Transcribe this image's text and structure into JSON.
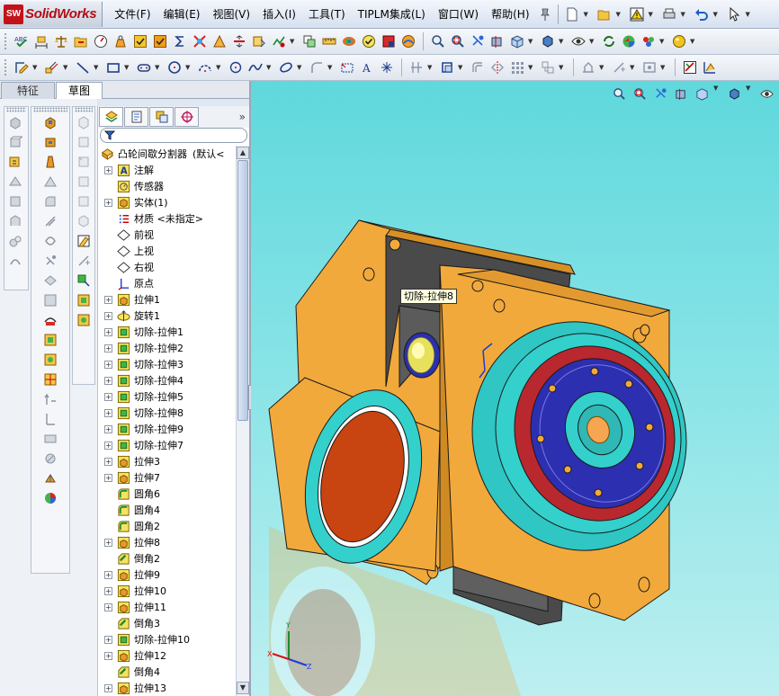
{
  "app": {
    "logo_badge": "SW",
    "logo_text": "SolidWorks"
  },
  "menu": [
    "文件(F)",
    "编辑(E)",
    "视图(V)",
    "插入(I)",
    "工具(T)",
    "TIPLM集成(L)",
    "窗口(W)",
    "帮助(H)"
  ],
  "command_tabs": {
    "features": "特征",
    "sketch": "草图"
  },
  "feature_tree": {
    "root": {
      "name": "凸轮间歇分割器",
      "config": "(默认<"
    },
    "items": [
      {
        "label": "注解",
        "icon": "annotation-icon",
        "expandable": true
      },
      {
        "label": "传感器",
        "icon": "sensor-icon",
        "expandable": false
      },
      {
        "label": "实体(1)",
        "icon": "solid-bodies-icon",
        "expandable": true
      },
      {
        "label": "材质 <未指定>",
        "icon": "material-icon",
        "expandable": false
      },
      {
        "label": "前视",
        "icon": "plane-icon",
        "expandable": false
      },
      {
        "label": "上视",
        "icon": "plane-icon",
        "expandable": false
      },
      {
        "label": "右视",
        "icon": "plane-icon",
        "expandable": false
      },
      {
        "label": "原点",
        "icon": "origin-icon",
        "expandable": false
      },
      {
        "label": "拉伸1",
        "icon": "extrude-icon",
        "expandable": true
      },
      {
        "label": "旋转1",
        "icon": "revolve-icon",
        "expandable": true
      },
      {
        "label": "切除-拉伸1",
        "icon": "cut-extrude-icon",
        "expandable": true
      },
      {
        "label": "切除-拉伸2",
        "icon": "cut-extrude-icon",
        "expandable": true
      },
      {
        "label": "切除-拉伸3",
        "icon": "cut-extrude-icon",
        "expandable": true
      },
      {
        "label": "切除-拉伸4",
        "icon": "cut-extrude-icon",
        "expandable": true
      },
      {
        "label": "切除-拉伸5",
        "icon": "cut-extrude-icon",
        "expandable": true
      },
      {
        "label": "切除-拉伸8",
        "icon": "cut-extrude-icon",
        "expandable": true
      },
      {
        "label": "切除-拉伸9",
        "icon": "cut-extrude-icon",
        "expandable": true
      },
      {
        "label": "切除-拉伸7",
        "icon": "cut-extrude-icon",
        "expandable": true
      },
      {
        "label": "拉伸3",
        "icon": "extrude-icon",
        "expandable": true
      },
      {
        "label": "拉伸7",
        "icon": "extrude-icon",
        "expandable": true
      },
      {
        "label": "圆角6",
        "icon": "fillet-icon",
        "expandable": false
      },
      {
        "label": "圆角4",
        "icon": "fillet-icon",
        "expandable": false
      },
      {
        "label": "圆角2",
        "icon": "fillet-icon",
        "expandable": false
      },
      {
        "label": "拉伸8",
        "icon": "extrude-icon",
        "expandable": true
      },
      {
        "label": "倒角2",
        "icon": "chamfer-icon",
        "expandable": false
      },
      {
        "label": "拉伸9",
        "icon": "extrude-icon",
        "expandable": true
      },
      {
        "label": "拉伸10",
        "icon": "extrude-icon",
        "expandable": true
      },
      {
        "label": "拉伸11",
        "icon": "extrude-icon",
        "expandable": true
      },
      {
        "label": "倒角3",
        "icon": "chamfer-icon",
        "expandable": false
      },
      {
        "label": "切除-拉伸10",
        "icon": "cut-extrude-icon",
        "expandable": true
      },
      {
        "label": "拉伸12",
        "icon": "extrude-icon",
        "expandable": true
      },
      {
        "label": "倒角4",
        "icon": "chamfer-icon",
        "expandable": false
      },
      {
        "label": "拉伸13",
        "icon": "extrude-icon",
        "expandable": true
      }
    ]
  },
  "viewport": {
    "tooltip": "切除-拉伸8",
    "background_color": "#7fe0e3",
    "model_colors": {
      "housing": "#f2a93b",
      "recess": "#4a4a4a",
      "flange": "#33d0cc",
      "ring": "#b8282e",
      "hub": "#2c2fb0",
      "cover": "#c84410"
    }
  },
  "colors": {
    "accent": "#b20d15",
    "toolbar_bg": "#dfe5ee",
    "tree_bg": "#ffffff"
  }
}
